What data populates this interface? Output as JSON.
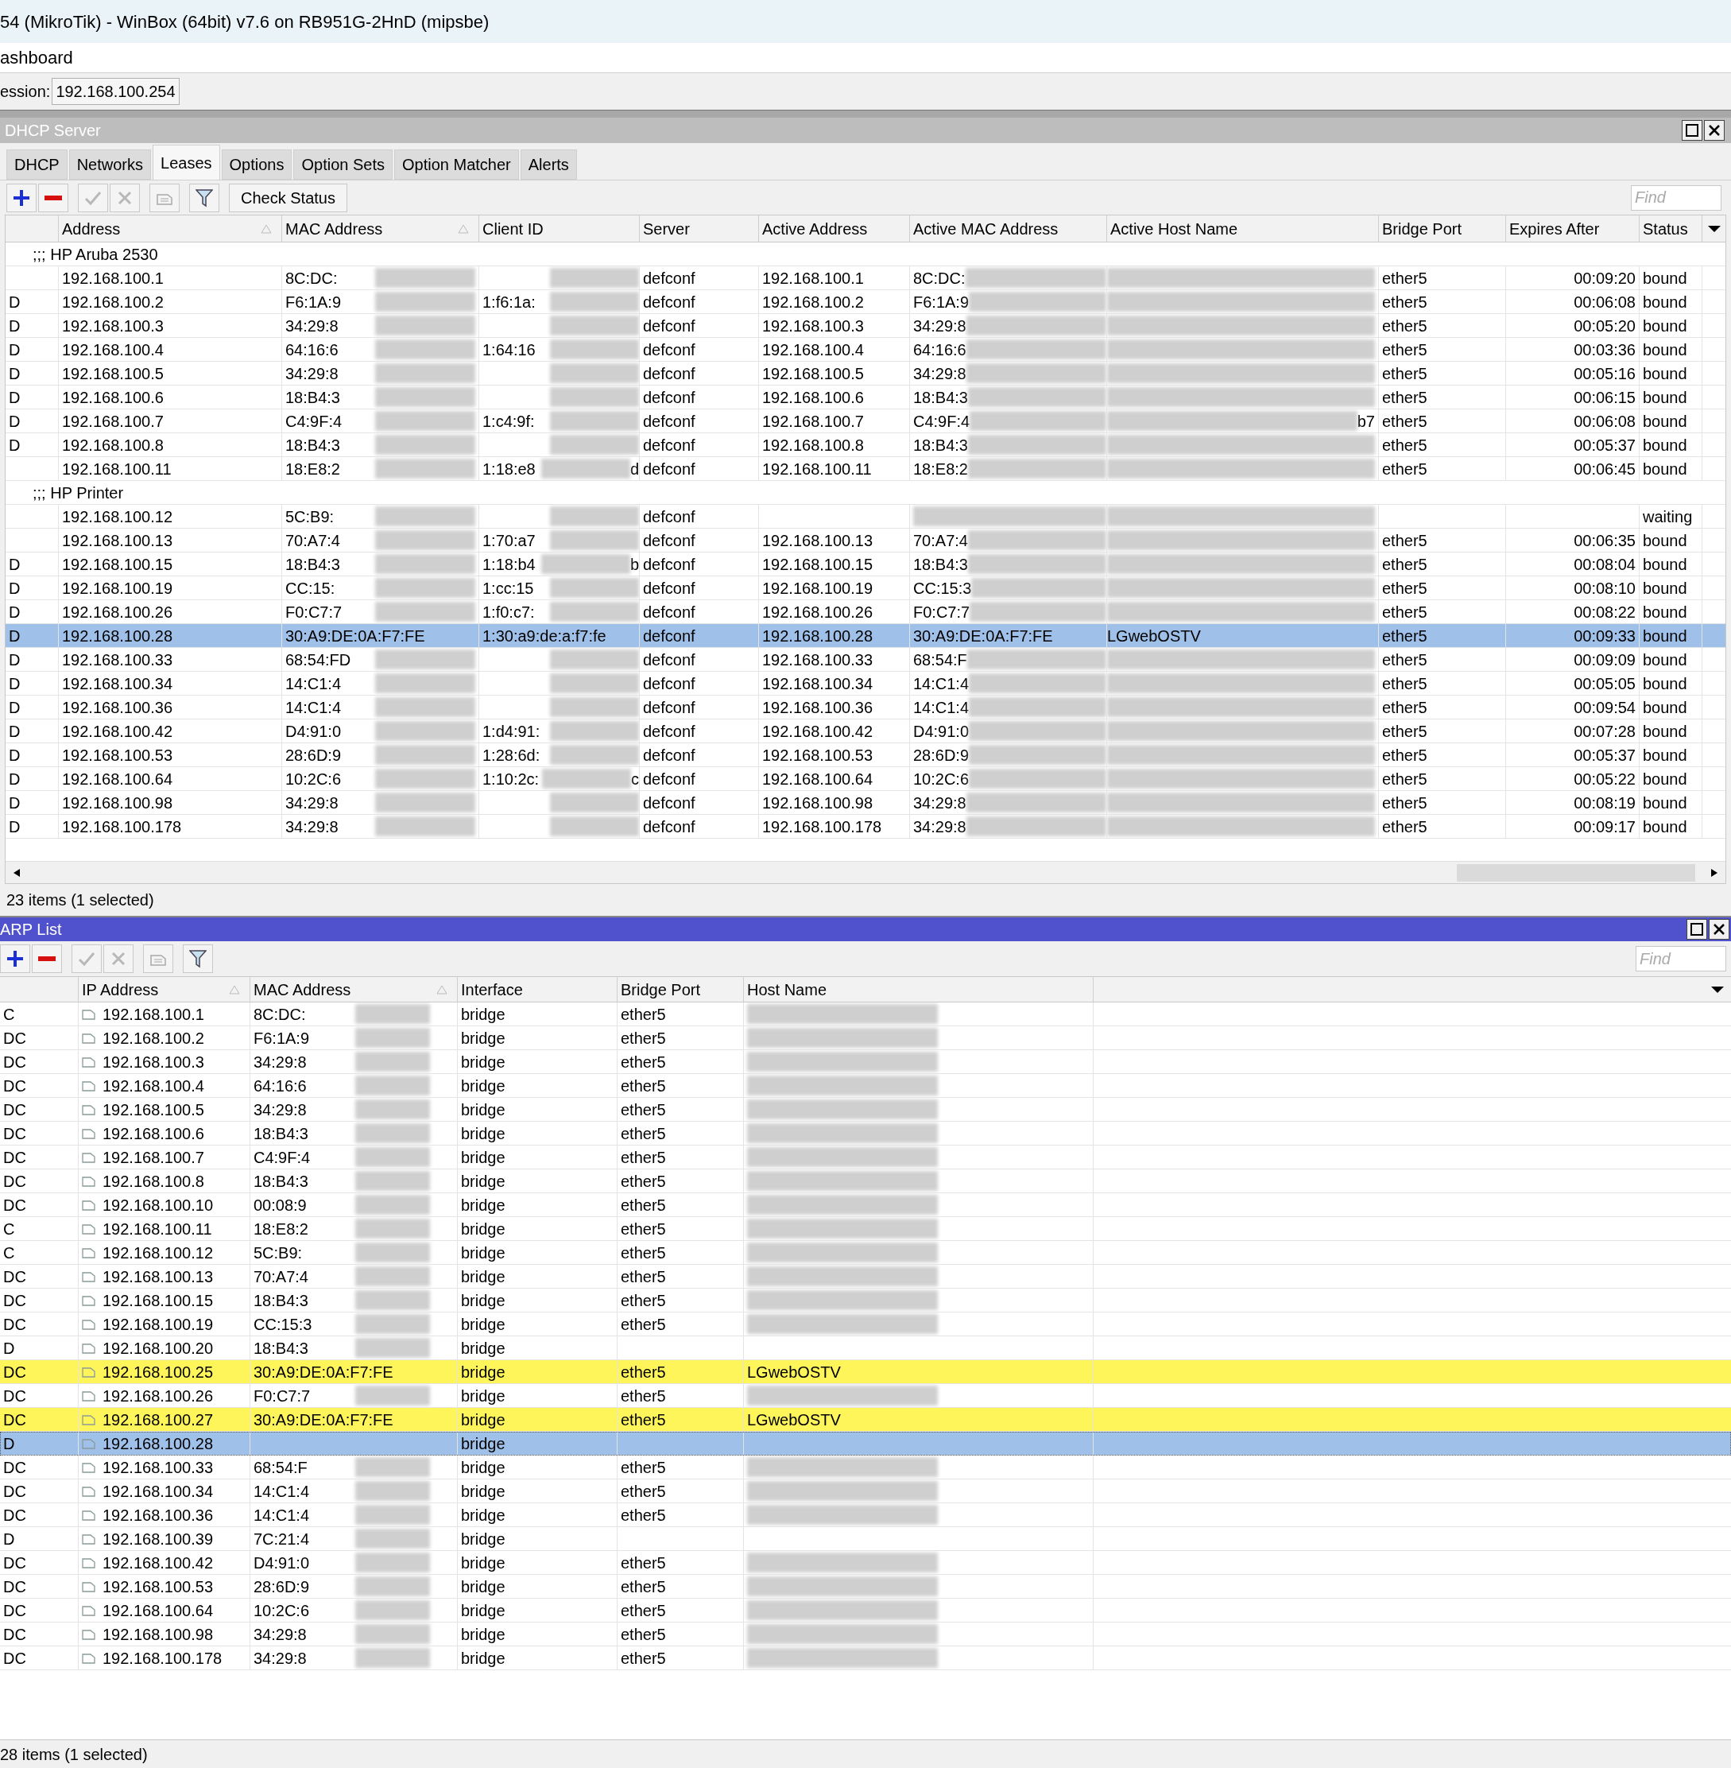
{
  "window": {
    "title": "54 (MikroTik) - WinBox (64bit) v7.6 on RB951G-2HnD (mipsbe)",
    "menu_label": "ashboard",
    "session_label": "ession:",
    "session_value": "192.168.100.254"
  },
  "dhcp": {
    "title": "DHCP Server",
    "tabs": [
      {
        "label": "DHCP",
        "selected": false
      },
      {
        "label": "Networks",
        "selected": false
      },
      {
        "label": "Leases",
        "selected": true
      },
      {
        "label": "Options",
        "selected": false
      },
      {
        "label": "Option Sets",
        "selected": false
      },
      {
        "label": "Option Matcher",
        "selected": false
      },
      {
        "label": "Alerts",
        "selected": false
      }
    ],
    "check_status": "Check Status",
    "find_placeholder": "Find",
    "columns": [
      "Address",
      "MAC Address",
      "Client ID",
      "Server",
      "Active Address",
      "Active MAC Address",
      "Active Host Name",
      "Bridge Port",
      "Expires After",
      "Status"
    ],
    "rows": [
      {
        "kind": "group",
        "comment": ";;; HP Aruba 2530"
      },
      {
        "kind": "lease",
        "flag": "",
        "address": "192.168.100.1",
        "mac": "8C:DC:",
        "client_id": "",
        "server": "defconf",
        "active_address": "192.168.100.1",
        "active_mac": "8C:DC:",
        "bridge_port": "ether5",
        "expires": "00:09:20",
        "status": "bound",
        "selected": false,
        "redacted": true
      },
      {
        "kind": "lease",
        "flag": "D",
        "address": "192.168.100.2",
        "mac": "F6:1A:9",
        "client_id": "1:f6:1a:",
        "server": "defconf",
        "active_address": "192.168.100.2",
        "active_mac": "F6:1A:9",
        "bridge_port": "ether5",
        "expires": "00:06:08",
        "status": "bound",
        "selected": false,
        "redacted": true
      },
      {
        "kind": "lease",
        "flag": "D",
        "address": "192.168.100.3",
        "mac": "34:29:8",
        "client_id": "",
        "server": "defconf",
        "active_address": "192.168.100.3",
        "active_mac": "34:29:8",
        "bridge_port": "ether5",
        "expires": "00:05:20",
        "status": "bound",
        "selected": false,
        "redacted": true
      },
      {
        "kind": "lease",
        "flag": "D",
        "address": "192.168.100.4",
        "mac": "64:16:6",
        "client_id": "1:64:16",
        "server": "defconf",
        "active_address": "192.168.100.4",
        "active_mac": "64:16:6",
        "bridge_port": "ether5",
        "expires": "00:03:36",
        "status": "bound",
        "selected": false,
        "redacted": true
      },
      {
        "kind": "lease",
        "flag": "D",
        "address": "192.168.100.5",
        "mac": "34:29:8",
        "client_id": "",
        "server": "defconf",
        "active_address": "192.168.100.5",
        "active_mac": "34:29:8",
        "bridge_port": "ether5",
        "expires": "00:05:16",
        "status": "bound",
        "selected": false,
        "redacted": true
      },
      {
        "kind": "lease",
        "flag": "D",
        "address": "192.168.100.6",
        "mac": "18:B4:3",
        "client_id": "",
        "server": "defconf",
        "active_address": "192.168.100.6",
        "active_mac": "18:B4:3",
        "bridge_port": "ether5",
        "expires": "00:06:15",
        "status": "bound",
        "selected": false,
        "redacted": true
      },
      {
        "kind": "lease",
        "flag": "D",
        "address": "192.168.100.7",
        "mac": "C4:9F:4",
        "client_id": "1:c4:9f:",
        "server": "defconf",
        "active_address": "192.168.100.7",
        "active_mac": "C4:9F:4",
        "host_tail": "b7",
        "bridge_port": "ether5",
        "expires": "00:06:08",
        "status": "bound",
        "selected": false,
        "redacted": true
      },
      {
        "kind": "lease",
        "flag": "D",
        "address": "192.168.100.8",
        "mac": "18:B4:3",
        "client_id": "",
        "server": "defconf",
        "active_address": "192.168.100.8",
        "active_mac": "18:B4:3",
        "bridge_port": "ether5",
        "expires": "00:05:37",
        "status": "bound",
        "selected": false,
        "redacted": true
      },
      {
        "kind": "lease",
        "flag": "",
        "address": "192.168.100.11",
        "mac": "18:E8:2",
        "client_id": "1:18:e8",
        "client_tail": "d",
        "server": "defconf",
        "active_address": "192.168.100.11",
        "active_mac": "18:E8:2",
        "bridge_port": "ether5",
        "expires": "00:06:45",
        "status": "bound",
        "selected": false,
        "redacted": true
      },
      {
        "kind": "group",
        "comment": ";;; HP Printer"
      },
      {
        "kind": "lease",
        "flag": "",
        "address": "192.168.100.12",
        "mac": "5C:B9:",
        "client_id": "",
        "server": "defconf",
        "active_address": "",
        "active_mac": "",
        "bridge_port": "",
        "expires": "",
        "status": "waiting",
        "selected": false,
        "redacted": true
      },
      {
        "kind": "lease",
        "flag": "",
        "address": "192.168.100.13",
        "mac": "70:A7:4",
        "client_id": "1:70:a7",
        "server": "defconf",
        "active_address": "192.168.100.13",
        "active_mac": "70:A7:4",
        "bridge_port": "ether5",
        "expires": "00:06:35",
        "status": "bound",
        "selected": false,
        "redacted": true
      },
      {
        "kind": "lease",
        "flag": "D",
        "address": "192.168.100.15",
        "mac": "18:B4:3",
        "client_id": "1:18:b4",
        "client_tail": "b",
        "server": "defconf",
        "active_address": "192.168.100.15",
        "active_mac": "18:B4:3",
        "bridge_port": "ether5",
        "expires": "00:08:04",
        "status": "bound",
        "selected": false,
        "redacted": true
      },
      {
        "kind": "lease",
        "flag": "D",
        "address": "192.168.100.19",
        "mac": "CC:15:",
        "client_id": "1:cc:15",
        "server": "defconf",
        "active_address": "192.168.100.19",
        "active_mac": "CC:15:3",
        "bridge_port": "ether5",
        "expires": "00:08:10",
        "status": "bound",
        "selected": false,
        "redacted": true
      },
      {
        "kind": "lease",
        "flag": "D",
        "address": "192.168.100.26",
        "mac": "F0:C7:7",
        "client_id": "1:f0:c7:",
        "server": "defconf",
        "active_address": "192.168.100.26",
        "active_mac": "F0:C7:7",
        "bridge_port": "ether5",
        "expires": "00:08:22",
        "status": "bound",
        "selected": false,
        "redacted": true
      },
      {
        "kind": "lease",
        "flag": "D",
        "address": "192.168.100.28",
        "mac": "30:A9:DE:0A:F7:FE",
        "client_id": "1:30:a9:de:a:f7:fe",
        "server": "defconf",
        "active_address": "192.168.100.28",
        "active_mac": "30:A9:DE:0A:F7:FE",
        "active_host": "LGwebOSTV",
        "bridge_port": "ether5",
        "expires": "00:09:33",
        "status": "bound",
        "selected": true,
        "redacted": false
      },
      {
        "kind": "lease",
        "flag": "D",
        "address": "192.168.100.33",
        "mac": "68:54:FD",
        "client_id": "",
        "server": "defconf",
        "active_address": "192.168.100.33",
        "active_mac": "68:54:F",
        "bridge_port": "ether5",
        "expires": "00:09:09",
        "status": "bound",
        "selected": false,
        "redacted": true
      },
      {
        "kind": "lease",
        "flag": "D",
        "address": "192.168.100.34",
        "mac": "14:C1:4",
        "client_id": "",
        "server": "defconf",
        "active_address": "192.168.100.34",
        "active_mac": "14:C1:4",
        "bridge_port": "ether5",
        "expires": "00:05:05",
        "status": "bound",
        "selected": false,
        "redacted": true
      },
      {
        "kind": "lease",
        "flag": "D",
        "address": "192.168.100.36",
        "mac": "14:C1:4",
        "client_id": "",
        "server": "defconf",
        "active_address": "192.168.100.36",
        "active_mac": "14:C1:4",
        "bridge_port": "ether5",
        "expires": "00:09:54",
        "status": "bound",
        "selected": false,
        "redacted": true
      },
      {
        "kind": "lease",
        "flag": "D",
        "address": "192.168.100.42",
        "mac": "D4:91:0",
        "client_id": "1:d4:91:",
        "server": "defconf",
        "active_address": "192.168.100.42",
        "active_mac": "D4:91:0",
        "bridge_port": "ether5",
        "expires": "00:07:28",
        "status": "bound",
        "selected": false,
        "redacted": true
      },
      {
        "kind": "lease",
        "flag": "D",
        "address": "192.168.100.53",
        "mac": "28:6D:9",
        "client_id": "1:28:6d:",
        "server": "defconf",
        "active_address": "192.168.100.53",
        "active_mac": "28:6D:9",
        "bridge_port": "ether5",
        "expires": "00:05:37",
        "status": "bound",
        "selected": false,
        "redacted": true
      },
      {
        "kind": "lease",
        "flag": "D",
        "address": "192.168.100.64",
        "mac": "10:2C:6",
        "client_id": "1:10:2c:",
        "client_tail": "c",
        "server": "defconf",
        "active_address": "192.168.100.64",
        "active_mac": "10:2C:6",
        "bridge_port": "ether5",
        "expires": "00:05:22",
        "status": "bound",
        "selected": false,
        "redacted": true
      },
      {
        "kind": "lease",
        "flag": "D",
        "address": "192.168.100.98",
        "mac": "34:29:8",
        "client_id": "",
        "server": "defconf",
        "active_address": "192.168.100.98",
        "active_mac": "34:29:8",
        "bridge_port": "ether5",
        "expires": "00:08:19",
        "status": "bound",
        "selected": false,
        "redacted": true
      },
      {
        "kind": "lease",
        "flag": "D",
        "address": "192.168.100.178",
        "mac": "34:29:8",
        "client_id": "",
        "server": "defconf",
        "active_address": "192.168.100.178",
        "active_mac": "34:29:8",
        "bridge_port": "ether5",
        "expires": "00:09:17",
        "status": "bound",
        "selected": false,
        "redacted": true
      }
    ],
    "status_bar": "23 items (1 selected)"
  },
  "arp": {
    "title": "ARP List",
    "find_placeholder": "Find",
    "columns": [
      "IP Address",
      "MAC Address",
      "Interface",
      "Bridge Port",
      "Host Name"
    ],
    "rows": [
      {
        "flag": "C",
        "ip": "192.168.100.1",
        "mac": "8C:DC:",
        "interface": "bridge",
        "bridge_port": "ether5",
        "host": "",
        "highlighted": false,
        "selected": false,
        "redacted": true
      },
      {
        "flag": "DC",
        "ip": "192.168.100.2",
        "mac": "F6:1A:9",
        "interface": "bridge",
        "bridge_port": "ether5",
        "host": "",
        "highlighted": false,
        "selected": false,
        "redacted": true
      },
      {
        "flag": "DC",
        "ip": "192.168.100.3",
        "mac": "34:29:8",
        "interface": "bridge",
        "bridge_port": "ether5",
        "host": "",
        "highlighted": false,
        "selected": false,
        "redacted": true
      },
      {
        "flag": "DC",
        "ip": "192.168.100.4",
        "mac": "64:16:6",
        "interface": "bridge",
        "bridge_port": "ether5",
        "host": "",
        "highlighted": false,
        "selected": false,
        "redacted": true
      },
      {
        "flag": "DC",
        "ip": "192.168.100.5",
        "mac": "34:29:8",
        "interface": "bridge",
        "bridge_port": "ether5",
        "host": "",
        "highlighted": false,
        "selected": false,
        "redacted": true
      },
      {
        "flag": "DC",
        "ip": "192.168.100.6",
        "mac": "18:B4:3",
        "interface": "bridge",
        "bridge_port": "ether5",
        "host": "",
        "highlighted": false,
        "selected": false,
        "redacted": true
      },
      {
        "flag": "DC",
        "ip": "192.168.100.7",
        "mac": "C4:9F:4",
        "interface": "bridge",
        "bridge_port": "ether5",
        "host": "",
        "highlighted": false,
        "selected": false,
        "redacted": true
      },
      {
        "flag": "DC",
        "ip": "192.168.100.8",
        "mac": "18:B4:3",
        "interface": "bridge",
        "bridge_port": "ether5",
        "host": "",
        "highlighted": false,
        "selected": false,
        "redacted": true
      },
      {
        "flag": "DC",
        "ip": "192.168.100.10",
        "mac": "00:08:9",
        "interface": "bridge",
        "bridge_port": "ether5",
        "host": "",
        "highlighted": false,
        "selected": false,
        "redacted": true
      },
      {
        "flag": "C",
        "ip": "192.168.100.11",
        "mac": "18:E8:2",
        "interface": "bridge",
        "bridge_port": "ether5",
        "host": "",
        "highlighted": false,
        "selected": false,
        "redacted": true
      },
      {
        "flag": "C",
        "ip": "192.168.100.12",
        "mac": "5C:B9:",
        "interface": "bridge",
        "bridge_port": "ether5",
        "host": "",
        "highlighted": false,
        "selected": false,
        "redacted": true
      },
      {
        "flag": "DC",
        "ip": "192.168.100.13",
        "mac": "70:A7:4",
        "interface": "bridge",
        "bridge_port": "ether5",
        "host": "",
        "highlighted": false,
        "selected": false,
        "redacted": true
      },
      {
        "flag": "DC",
        "ip": "192.168.100.15",
        "mac": "18:B4:3",
        "interface": "bridge",
        "bridge_port": "ether5",
        "host": "",
        "highlighted": false,
        "selected": false,
        "redacted": true
      },
      {
        "flag": "DC",
        "ip": "192.168.100.19",
        "mac": "CC:15:3",
        "interface": "bridge",
        "bridge_port": "ether5",
        "host": "",
        "highlighted": false,
        "selected": false,
        "redacted": true
      },
      {
        "flag": "D",
        "ip": "192.168.100.20",
        "mac": "18:B4:3",
        "interface": "bridge",
        "bridge_port": "",
        "host": "",
        "highlighted": false,
        "selected": false,
        "redacted": true
      },
      {
        "flag": "DC",
        "ip": "192.168.100.25",
        "mac": "30:A9:DE:0A:F7:FE",
        "interface": "bridge",
        "bridge_port": "ether5",
        "host": "LGwebOSTV",
        "highlighted": true,
        "selected": false,
        "redacted": false
      },
      {
        "flag": "DC",
        "ip": "192.168.100.26",
        "mac": "F0:C7:7",
        "interface": "bridge",
        "bridge_port": "ether5",
        "host": "",
        "highlighted": false,
        "selected": false,
        "redacted": true
      },
      {
        "flag": "DC",
        "ip": "192.168.100.27",
        "mac": "30:A9:DE:0A:F7:FE",
        "interface": "bridge",
        "bridge_port": "ether5",
        "host": "LGwebOSTV",
        "highlighted": true,
        "selected": false,
        "redacted": false
      },
      {
        "flag": "D",
        "ip": "192.168.100.28",
        "mac": "",
        "interface": "bridge",
        "bridge_port": "",
        "host": "",
        "highlighted": false,
        "selected": true,
        "redacted": false
      },
      {
        "flag": "DC",
        "ip": "192.168.100.33",
        "mac": "68:54:F",
        "interface": "bridge",
        "bridge_port": "ether5",
        "host": "",
        "highlighted": false,
        "selected": false,
        "redacted": true
      },
      {
        "flag": "DC",
        "ip": "192.168.100.34",
        "mac": "14:C1:4",
        "interface": "bridge",
        "bridge_port": "ether5",
        "host": "",
        "highlighted": false,
        "selected": false,
        "redacted": true
      },
      {
        "flag": "DC",
        "ip": "192.168.100.36",
        "mac": "14:C1:4",
        "interface": "bridge",
        "bridge_port": "ether5",
        "host": "",
        "highlighted": false,
        "selected": false,
        "redacted": true
      },
      {
        "flag": "D",
        "ip": "192.168.100.39",
        "mac": "7C:21:4",
        "interface": "bridge",
        "bridge_port": "",
        "host": "",
        "highlighted": false,
        "selected": false,
        "redacted": true
      },
      {
        "flag": "DC",
        "ip": "192.168.100.42",
        "mac": "D4:91:0",
        "interface": "bridge",
        "bridge_port": "ether5",
        "host": "",
        "highlighted": false,
        "selected": false,
        "redacted": true
      },
      {
        "flag": "DC",
        "ip": "192.168.100.53",
        "mac": "28:6D:9",
        "interface": "bridge",
        "bridge_port": "ether5",
        "host": "",
        "highlighted": false,
        "selected": false,
        "redacted": true
      },
      {
        "flag": "DC",
        "ip": "192.168.100.64",
        "mac": "10:2C:6",
        "interface": "bridge",
        "bridge_port": "ether5",
        "host": "",
        "highlighted": false,
        "selected": false,
        "redacted": true
      },
      {
        "flag": "DC",
        "ip": "192.168.100.98",
        "mac": "34:29:8",
        "interface": "bridge",
        "bridge_port": "ether5",
        "host": "",
        "highlighted": false,
        "selected": false,
        "redacted": true
      },
      {
        "flag": "DC",
        "ip": "192.168.100.178",
        "mac": "34:29:8",
        "interface": "bridge",
        "bridge_port": "ether5",
        "host": "",
        "highlighted": false,
        "selected": false,
        "redacted": true
      }
    ],
    "status_bar": "28 items (1 selected)"
  }
}
